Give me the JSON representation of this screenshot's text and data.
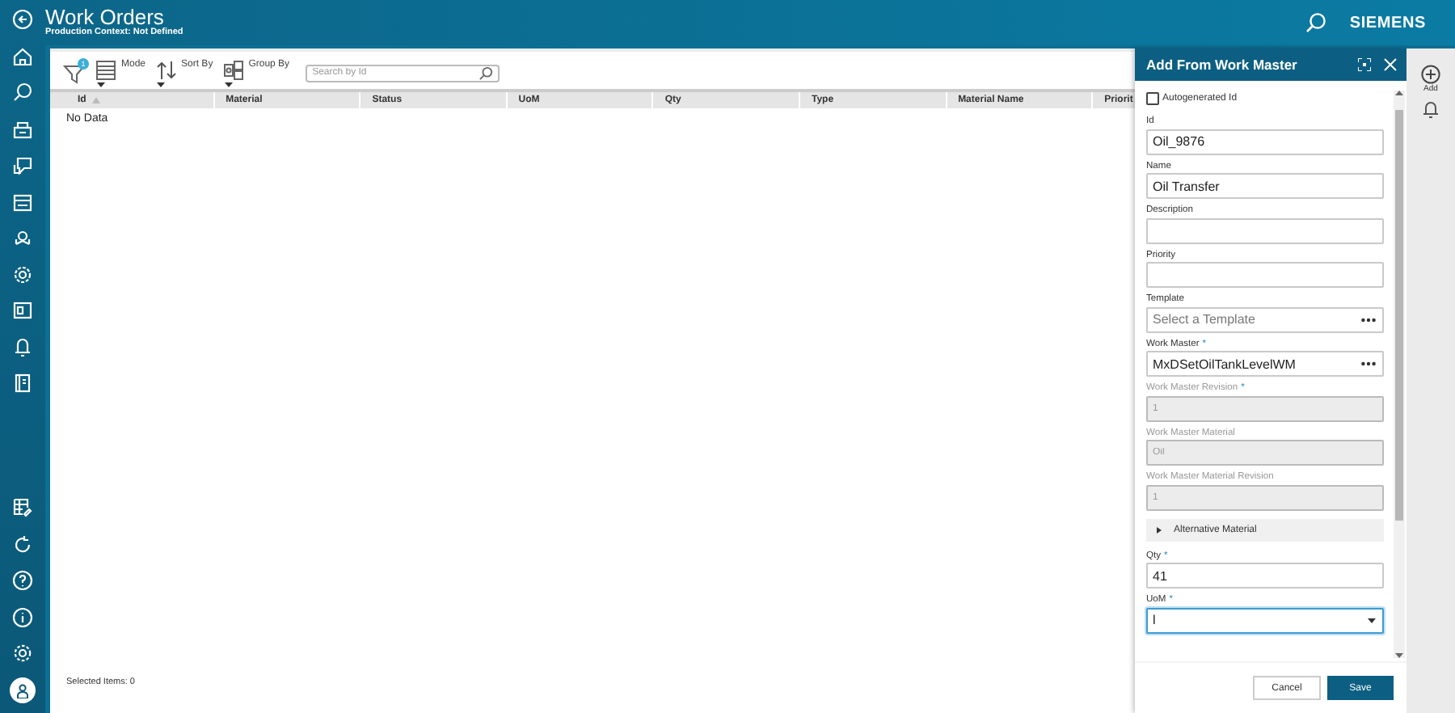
{
  "header": {
    "title": "Work Orders",
    "subtitle": "Production Context: Not Defined",
    "brand": "SIEMENS"
  },
  "toolbar": {
    "filter_badge": "1",
    "buttons": [
      {
        "label": "Mode",
        "kind": "mode"
      },
      {
        "label": "Sort By",
        "kind": "sort"
      },
      {
        "label": "Group By",
        "kind": "group"
      }
    ],
    "search": {
      "placeholder": "Search by Id"
    }
  },
  "table": {
    "columns": [
      {
        "label": "Id",
        "sorted": true
      },
      {
        "label": "Material",
        "sorted": false
      },
      {
        "label": "Status",
        "sorted": false
      },
      {
        "label": "UoM",
        "sorted": false
      },
      {
        "label": "Qty",
        "sorted": false
      },
      {
        "label": "Type",
        "sorted": false
      },
      {
        "label": "Material Name",
        "sorted": false
      },
      {
        "label": "Priorit",
        "sorted": false
      }
    ],
    "empty_text": "No Data"
  },
  "status_bar": {
    "text": "Selected Items: 0"
  },
  "panel": {
    "title": "Add From Work Master",
    "fields": [
      {
        "kind": "checkbox",
        "label": "Autogenerated Id",
        "checked": false
      },
      {
        "kind": "text",
        "label": "Id",
        "value": "Oil_9876",
        "disabled": false,
        "focused": false
      },
      {
        "kind": "text",
        "label": "Name",
        "value": "Oil Transfer",
        "disabled": false,
        "focused": false
      },
      {
        "kind": "text",
        "label": "Description",
        "disabled": false,
        "focused": false
      },
      {
        "kind": "text",
        "label": "Priority",
        "disabled": false,
        "focused": false
      },
      {
        "kind": "picker",
        "label": "Template",
        "placeholder": "Select a Template",
        "disabled": false,
        "focused": false
      },
      {
        "kind": "picker",
        "label": "Work Master",
        "marker": "*",
        "value": "MxDSetOilTankLevelWM",
        "disabled": false,
        "focused": false
      },
      {
        "kind": "text",
        "label": "Work Master Revision",
        "marker": "*",
        "value": "1",
        "disabled": true,
        "focused": false
      },
      {
        "kind": "text",
        "label": "Work Master Material",
        "value": "Oil",
        "disabled": true,
        "focused": false
      },
      {
        "kind": "text",
        "label": "Work Master Material Revision",
        "value": "1",
        "disabled": true,
        "focused": false
      },
      {
        "kind": "section",
        "label": "Alternative Material",
        "expanded": false
      },
      {
        "kind": "text",
        "label": "Qty",
        "marker": "*",
        "value": "41",
        "disabled": false,
        "focused": false
      },
      {
        "kind": "dropdown",
        "label": "UoM",
        "marker": "*",
        "value": "l",
        "disabled": false,
        "focused": true
      }
    ],
    "buttons": [
      {
        "label": "Cancel",
        "primary": false
      },
      {
        "label": "Save",
        "primary": true
      }
    ]
  },
  "rail": {
    "items": [
      {
        "kind": "add",
        "label": "Add"
      },
      {
        "kind": "bell"
      }
    ]
  }
}
